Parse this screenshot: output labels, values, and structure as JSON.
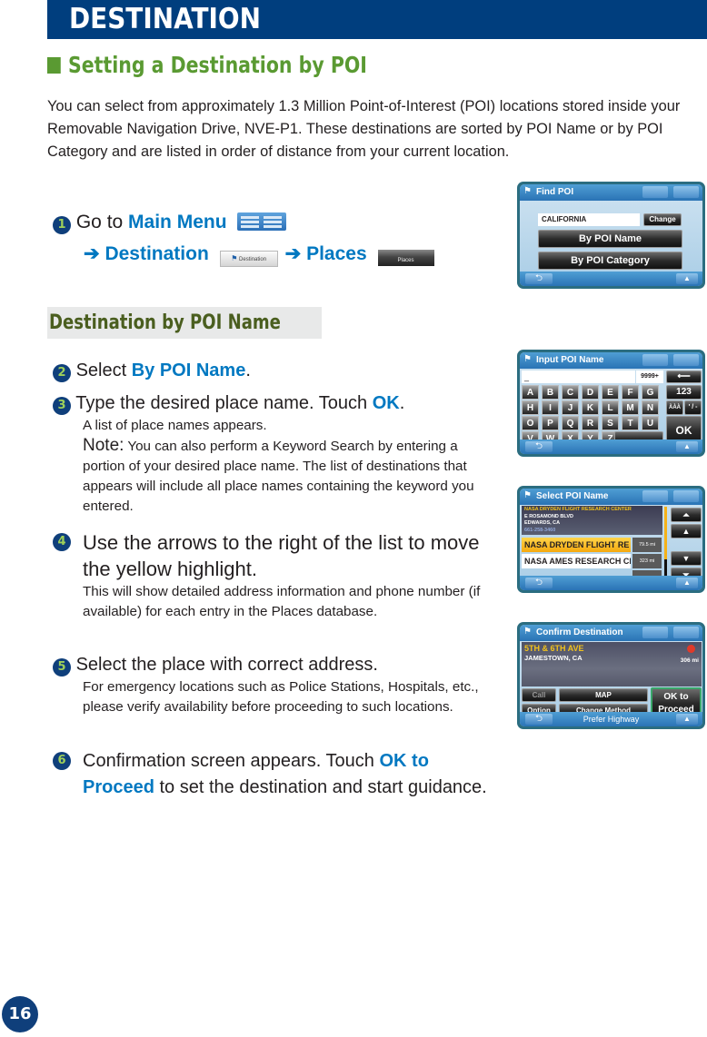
{
  "header": {
    "title": "DESTINATION"
  },
  "section": {
    "title": "Setting a Destination by POI"
  },
  "intro": "You can select from approximately 1.3 Million Point-of-Interest (POI) locations stored inside your Removable Navigation Drive, NVE-P1. These destinations are sorted by POI Name or by POI Category and are listed in order of distance from your current location.",
  "step1": {
    "num": "1",
    "prefix": "Go to ",
    "main_menu": "Main Menu",
    "arrow": "➔",
    "destination": "Destination",
    "destination_icon_label": "Destination",
    "places": "Places",
    "places_icon_label": "Places"
  },
  "subhead": "Destination by POI Name",
  "steps": [
    {
      "num": "2",
      "pre": "Select ",
      "hl": "By POI Name",
      "post": "."
    },
    {
      "num": "3",
      "pre": "Type the desired place name. Touch ",
      "hl": "OK",
      "post": ".",
      "body": "A list of place names appears.",
      "note_head": "Note:",
      "note": " You can also perform a Keyword Search by entering a portion of your desired place name. The list of destinations that appears will include all place names containing the keyword you entered."
    },
    {
      "num": "4",
      "text": "Use the arrows to the right of the list to move the yellow highlight.",
      "body": "This will show detailed address information and phone number (if available) for each entry in the Places database."
    },
    {
      "num": "5",
      "text": "Select the place with correct address.",
      "body": "For emergency locations such as Police Stations, Hospitals, etc., please verify availability before proceeding to such locations."
    },
    {
      "num": "6",
      "pre": "Confirmation screen appears. Touch ",
      "hl": "OK to Proceed",
      "post": " to set the destination and start guidance."
    }
  ],
  "page_number": "16",
  "screens": {
    "find_poi": {
      "title": "Find POI",
      "state_value": "CALIFORNIA",
      "change": "Change",
      "by_name": "By POI Name",
      "by_category": "By POI Category"
    },
    "input_poi": {
      "title": "Input POI Name",
      "input_value": "_",
      "count": "9999+",
      "backspace": "⟵",
      "rows": [
        [
          "A",
          "B",
          "C",
          "D",
          "E",
          "F",
          "G"
        ],
        [
          "H",
          "I",
          "J",
          "K",
          "L",
          "M",
          "N"
        ],
        [
          "O",
          "P",
          "Q",
          "R",
          "S",
          "T",
          "U"
        ],
        [
          "V",
          "W",
          "X",
          "Y",
          "Z"
        ]
      ],
      "num_key": "123",
      "accent_key": "ÀÀÀ",
      "symbol_key": "' / -",
      "ok": "OK",
      "space": "⎵"
    },
    "select_poi": {
      "title": "Select POI Name",
      "detail_name": "NASA DRYDEN FLIGHT RESEARCH CENTER",
      "detail_street": "E ROSAMOND BLVD",
      "detail_city": "EDWARDS, CA",
      "detail_phone": "661-258-3460",
      "items": [
        {
          "name": "NASA DRYDEN FLIGHT RE",
          "distance": "79.5 mi",
          "highlight": true
        },
        {
          "name": "NASA AMES RESEARCH CE",
          "distance": "323 mi",
          "highlight": false
        }
      ]
    },
    "confirm": {
      "title": "Confirm Destination",
      "street": "5TH & 6TH AVE",
      "city": "JAMESTOWN, CA",
      "distance": "306 mi",
      "call": "Call",
      "map": "MAP",
      "option": "Option",
      "change_method": "Change Method",
      "ok_line1": "OK  to",
      "ok_line2": "Proceed",
      "route": "Prefer Highway"
    }
  }
}
